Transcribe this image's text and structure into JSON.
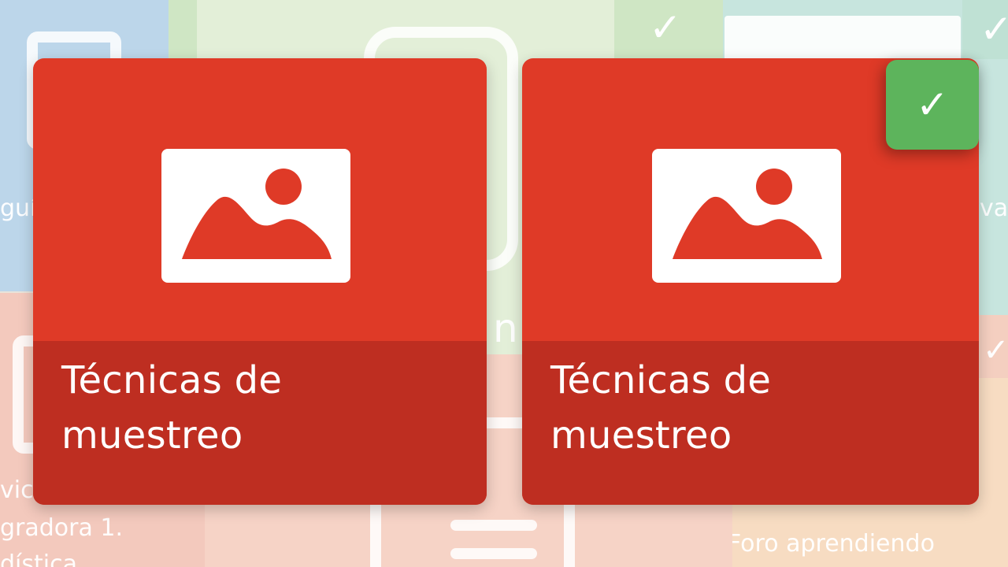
{
  "colors": {
    "card_background": "#df3a27",
    "card_footer": "#be2e21",
    "completed_badge": "#5db45c",
    "icon": "#ffffff"
  },
  "cards": [
    {
      "title": "Técnicas de muestreo",
      "icon": "image-icon",
      "completed": false
    },
    {
      "title": "Técnicas de muestreo",
      "icon": "image-icon",
      "completed": true,
      "badge_icon": "checkmark-icon",
      "badge_glyph": "✓"
    }
  ],
  "background": {
    "partial_labels": {
      "top_left": "guí",
      "top_right": "va",
      "middle": "n",
      "bottom_left_line1": "vic",
      "bottom_left_line2": "gradora 1.",
      "bottom_left_line3": "dística",
      "bottom_right": "Foro aprendiendo"
    },
    "check_glyph": "✓"
  }
}
